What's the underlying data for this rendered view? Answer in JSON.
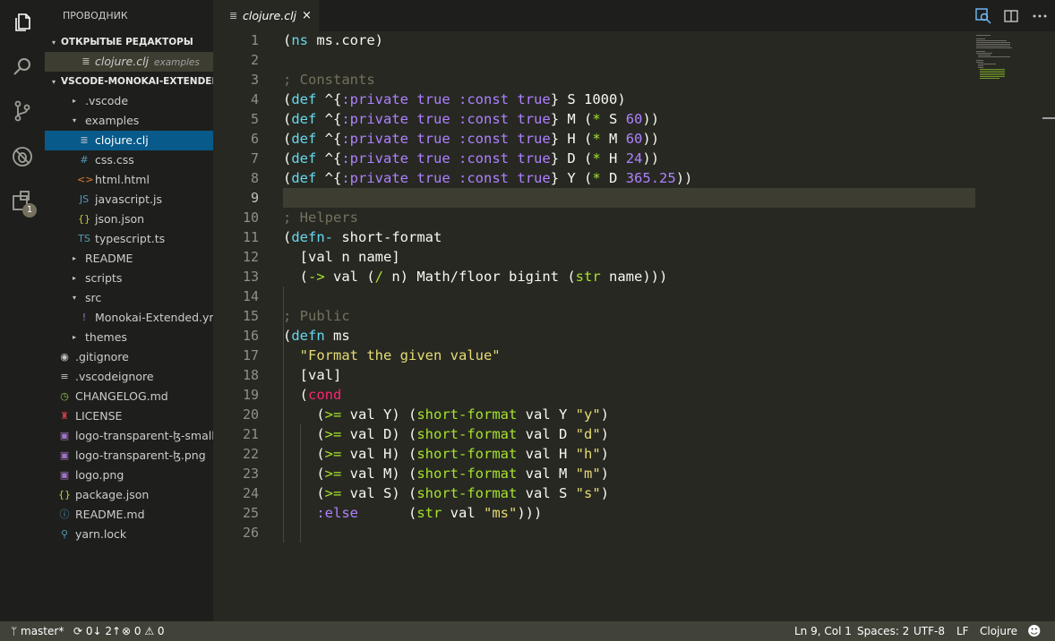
{
  "sidebar": {
    "title": "ПРОВОДНИК",
    "open_editors_label": "ОТКРЫТЫЕ РЕДАКТОРЫ",
    "open_editor": {
      "name": "clojure.clj",
      "hint": "examples"
    },
    "project_label": "VSCODE-MONOKAI-EXTENDED",
    "items": [
      {
        "label": ".vscode",
        "twist": "▸",
        "icon": "",
        "icon_name": "folder",
        "color": "#c5c5c5"
      },
      {
        "label": "examples",
        "twist": "▾",
        "icon": "",
        "icon_name": "folder",
        "color": "#c5c5c5"
      },
      {
        "label": "clojure.clj",
        "twist": "",
        "icon": "≣",
        "icon_name": "clojure-file-icon",
        "color": "#c5c5c5"
      },
      {
        "label": "css.css",
        "twist": "",
        "icon": "#",
        "icon_name": "css-file-icon",
        "color": "#519aba"
      },
      {
        "label": "html.html",
        "twist": "",
        "icon": "<>",
        "icon_name": "html-file-icon",
        "color": "#e37933"
      },
      {
        "label": "javascript.js",
        "twist": "",
        "icon": "JS",
        "icon_name": "javascript-file-icon",
        "color": "#519aba"
      },
      {
        "label": "json.json",
        "twist": "",
        "icon": "{}",
        "icon_name": "json-file-icon",
        "color": "#cbcb41"
      },
      {
        "label": "typescript.ts",
        "twist": "",
        "icon": "TS",
        "icon_name": "typescript-file-icon",
        "color": "#519aba"
      },
      {
        "label": "README",
        "twist": "▸",
        "icon": "",
        "icon_name": "folder",
        "color": "#c5c5c5"
      },
      {
        "label": "scripts",
        "twist": "▸",
        "icon": "",
        "icon_name": "folder",
        "color": "#c5c5c5"
      },
      {
        "label": "src",
        "twist": "▾",
        "icon": "",
        "icon_name": "folder",
        "color": "#c5c5c5"
      },
      {
        "label": "Monokai-Extended.yml",
        "twist": "",
        "icon": "!",
        "icon_name": "yaml-file-icon",
        "color": "#a074c4"
      },
      {
        "label": "themes",
        "twist": "▸",
        "icon": "",
        "icon_name": "folder",
        "color": "#c5c5c5"
      },
      {
        "label": ".gitignore",
        "twist": "",
        "icon": "◉",
        "icon_name": "git-file-icon",
        "color": "#c5c5c5"
      },
      {
        "label": ".vscodeignore",
        "twist": "",
        "icon": "≡",
        "icon_name": "text-file-icon",
        "color": "#c5c5c5"
      },
      {
        "label": "CHANGELOG.md",
        "twist": "",
        "icon": "◷",
        "icon_name": "changelog-file-icon",
        "color": "#8dc149"
      },
      {
        "label": "LICENSE",
        "twist": "",
        "icon": "♜",
        "icon_name": "license-file-icon",
        "color": "#cc3e44"
      },
      {
        "label": "logo-transparent-ɮ-small...",
        "twist": "",
        "icon": "▣",
        "icon_name": "image-file-icon",
        "color": "#a074c4"
      },
      {
        "label": "logo-transparent-ɮ.png",
        "twist": "",
        "icon": "▣",
        "icon_name": "image-file-icon",
        "color": "#a074c4"
      },
      {
        "label": "logo.png",
        "twist": "",
        "icon": "▣",
        "icon_name": "image-file-icon",
        "color": "#a074c4"
      },
      {
        "label": "package.json",
        "twist": "",
        "icon": "{}",
        "icon_name": "json-file-icon",
        "color": "#cbcb41"
      },
      {
        "label": "README.md",
        "twist": "",
        "icon": "ⓘ",
        "icon_name": "info-file-icon",
        "color": "#519aba"
      },
      {
        "label": "yarn.lock",
        "twist": "",
        "icon": "⚲",
        "icon_name": "yarn-file-icon",
        "color": "#519aba"
      }
    ]
  },
  "tab": {
    "label": "clojure.clj",
    "close": "×"
  },
  "activity": {
    "extensions_badge": "1"
  },
  "editor": {
    "current_line": 9,
    "lines": [
      [
        [
          "(",
          "p"
        ],
        [
          "ns",
          "b"
        ],
        [
          " ms.core)",
          "p"
        ]
      ],
      [],
      [
        [
          "; Constants",
          "c"
        ]
      ],
      [
        [
          "(",
          "p"
        ],
        [
          "def",
          "b"
        ],
        [
          " ^{",
          "p"
        ],
        [
          ":private",
          "v"
        ],
        [
          " ",
          "p"
        ],
        [
          "true",
          "v"
        ],
        [
          " ",
          "p"
        ],
        [
          ":const",
          "v"
        ],
        [
          " ",
          "p"
        ],
        [
          "true",
          "v"
        ],
        [
          "} S ",
          "p"
        ],
        [
          "1000",
          "p"
        ],
        [
          ")",
          "p"
        ]
      ],
      [
        [
          "(",
          "p"
        ],
        [
          "def",
          "b"
        ],
        [
          " ^{",
          "p"
        ],
        [
          ":private",
          "v"
        ],
        [
          " ",
          "p"
        ],
        [
          "true",
          "v"
        ],
        [
          " ",
          "p"
        ],
        [
          ":const",
          "v"
        ],
        [
          " ",
          "p"
        ],
        [
          "true",
          "v"
        ],
        [
          "} M (",
          "p"
        ],
        [
          "*",
          "g"
        ],
        [
          " S ",
          "p"
        ],
        [
          "60",
          "v"
        ],
        [
          "))",
          "p"
        ]
      ],
      [
        [
          "(",
          "p"
        ],
        [
          "def",
          "b"
        ],
        [
          " ^{",
          "p"
        ],
        [
          ":private",
          "v"
        ],
        [
          " ",
          "p"
        ],
        [
          "true",
          "v"
        ],
        [
          " ",
          "p"
        ],
        [
          ":const",
          "v"
        ],
        [
          " ",
          "p"
        ],
        [
          "true",
          "v"
        ],
        [
          "} H (",
          "p"
        ],
        [
          "*",
          "g"
        ],
        [
          " M ",
          "p"
        ],
        [
          "60",
          "v"
        ],
        [
          "))",
          "p"
        ]
      ],
      [
        [
          "(",
          "p"
        ],
        [
          "def",
          "b"
        ],
        [
          " ^{",
          "p"
        ],
        [
          ":private",
          "v"
        ],
        [
          " ",
          "p"
        ],
        [
          "true",
          "v"
        ],
        [
          " ",
          "p"
        ],
        [
          ":const",
          "v"
        ],
        [
          " ",
          "p"
        ],
        [
          "true",
          "v"
        ],
        [
          "} D (",
          "p"
        ],
        [
          "*",
          "g"
        ],
        [
          " H ",
          "p"
        ],
        [
          "24",
          "v"
        ],
        [
          "))",
          "p"
        ]
      ],
      [
        [
          "(",
          "p"
        ],
        [
          "def",
          "b"
        ],
        [
          " ^{",
          "p"
        ],
        [
          ":private",
          "v"
        ],
        [
          " ",
          "p"
        ],
        [
          "true",
          "v"
        ],
        [
          " ",
          "p"
        ],
        [
          ":const",
          "v"
        ],
        [
          " ",
          "p"
        ],
        [
          "true",
          "v"
        ],
        [
          "} Y (",
          "p"
        ],
        [
          "*",
          "g"
        ],
        [
          " D ",
          "p"
        ],
        [
          "365.25",
          "v"
        ],
        [
          "))",
          "p"
        ]
      ],
      [],
      [
        [
          "; Helpers",
          "c"
        ]
      ],
      [
        [
          "(",
          "p"
        ],
        [
          "defn-",
          "b"
        ],
        [
          " short-format",
          "p"
        ]
      ],
      [
        [
          "  [val n name]",
          "p"
        ]
      ],
      [
        [
          "  (",
          "p"
        ],
        [
          "->",
          "g"
        ],
        [
          " val (",
          "p"
        ],
        [
          "/",
          "g"
        ],
        [
          " n) Math/floor bigint (",
          "p"
        ],
        [
          "str",
          "g"
        ],
        [
          " name)))",
          "p"
        ]
      ],
      [],
      [
        [
          "; Public",
          "c"
        ]
      ],
      [
        [
          "(",
          "p"
        ],
        [
          "defn",
          "b"
        ],
        [
          " ms",
          "p"
        ]
      ],
      [
        [
          "  ",
          "p"
        ],
        [
          "\"Format the given value\"",
          "s"
        ]
      ],
      [
        [
          "  [val]",
          "p"
        ]
      ],
      [
        [
          "  (",
          "p"
        ],
        [
          "cond",
          "k"
        ]
      ],
      [
        [
          "    (",
          "p"
        ],
        [
          ">=",
          "g"
        ],
        [
          " val Y) (",
          "p"
        ],
        [
          "short-format",
          "g"
        ],
        [
          " val Y ",
          "p"
        ],
        [
          "\"y\"",
          "s"
        ],
        [
          ")",
          "p"
        ]
      ],
      [
        [
          "    (",
          "p"
        ],
        [
          ">=",
          "g"
        ],
        [
          " val D) (",
          "p"
        ],
        [
          "short-format",
          "g"
        ],
        [
          " val D ",
          "p"
        ],
        [
          "\"d\"",
          "s"
        ],
        [
          ")",
          "p"
        ]
      ],
      [
        [
          "    (",
          "p"
        ],
        [
          ">=",
          "g"
        ],
        [
          " val H) (",
          "p"
        ],
        [
          "short-format",
          "g"
        ],
        [
          " val H ",
          "p"
        ],
        [
          "\"h\"",
          "s"
        ],
        [
          ")",
          "p"
        ]
      ],
      [
        [
          "    (",
          "p"
        ],
        [
          ">=",
          "g"
        ],
        [
          " val M) (",
          "p"
        ],
        [
          "short-format",
          "g"
        ],
        [
          " val M ",
          "p"
        ],
        [
          "\"m\"",
          "s"
        ],
        [
          ")",
          "p"
        ]
      ],
      [
        [
          "    (",
          "p"
        ],
        [
          ">=",
          "g"
        ],
        [
          " val S) (",
          "p"
        ],
        [
          "short-format",
          "g"
        ],
        [
          " val S ",
          "p"
        ],
        [
          "\"s\"",
          "s"
        ],
        [
          ")",
          "p"
        ]
      ],
      [
        [
          "    ",
          "p"
        ],
        [
          ":else",
          "v"
        ],
        [
          "      (",
          "p"
        ],
        [
          "str",
          "g"
        ],
        [
          " val ",
          "p"
        ],
        [
          "\"ms\"",
          "s"
        ],
        [
          ")))",
          "p"
        ]
      ],
      []
    ]
  },
  "colors": {
    "p": "#f8f8f2",
    "b": "#66d9ef",
    "v": "#ae81ff",
    "g": "#a6e22e",
    "s": "#e6db74",
    "c": "#75715e",
    "k": "#f92672"
  },
  "status": {
    "branch": "master*",
    "sync": "0↓ 2↑",
    "errors": "0",
    "warnings": "0",
    "position": "Ln 9, Col 1",
    "spaces": "Spaces: 2",
    "encoding": "UTF-8",
    "eol": "LF",
    "language": "Clojure"
  }
}
